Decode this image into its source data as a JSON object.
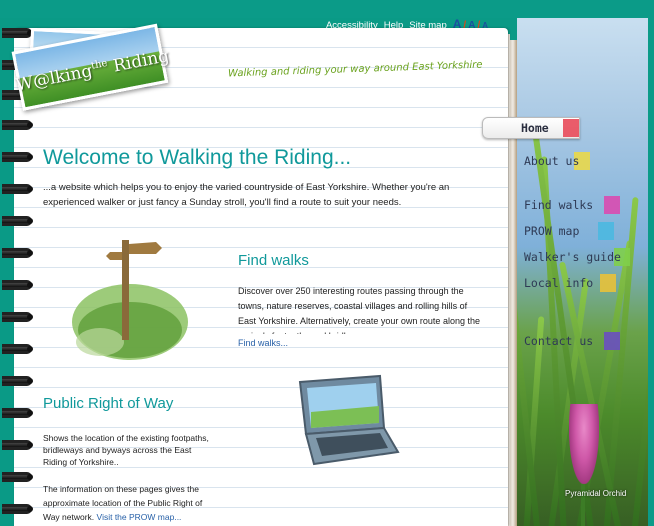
{
  "header": {
    "util_links": [
      "Accessibility",
      "Help",
      "Site map"
    ],
    "text_sizes": [
      "A",
      "A",
      "A"
    ],
    "size_separator": "/",
    "logo": {
      "word": "W@lking",
      "the": "the",
      "riding": "Riding"
    },
    "tagline": "Walking and riding your way around East Yorkshire"
  },
  "nav": {
    "items": [
      {
        "label": "Home",
        "tab_color": "#e84a5a"
      },
      {
        "label": "About us",
        "tab_color": "#e9d84a"
      },
      {
        "label": "Find walks",
        "tab_color": "#d94bb0"
      },
      {
        "label": "PROW map",
        "tab_color": "#4bb8e0"
      },
      {
        "label": "Walker's guide",
        "tab_color": "#7fcf4a"
      },
      {
        "label": "Local info",
        "tab_color": "#e8c13a"
      },
      {
        "label": "Contact us",
        "tab_color": "#6a4fc0"
      }
    ]
  },
  "sidebar": {
    "caption": "Pyramidal Orchid"
  },
  "main": {
    "welcome_title": "Welcome to Walking the Riding...",
    "intro": "...a website which helps you to enjoy the varied countryside of East Yorkshire.  Whether you're an experienced walker or just fancy a Sunday stroll, you'll find a route to suit your needs.",
    "find_walks": {
      "title": "Find walks",
      "text": "Discover over 250 interesting routes passing through the towns, nature reserves, coastal villages and rolling hills of East Yorkshire.  Alternatively, create your own route along the region's footpaths and bridleways.",
      "link": "Find walks..."
    },
    "prow": {
      "title": "Public Right of Way",
      "text1": "Shows the location of the existing footpaths, bridleways and byways across the East Riding of Yorkshire..",
      "text2": "The information on these pages gives the approximate location of the Public Right of Way network.",
      "link": "Visit the PROW map..."
    }
  },
  "colors": {
    "frame": "#0b9b88",
    "heading": "#10999b",
    "link": "#2861a8",
    "tagline": "#6aa21d"
  }
}
